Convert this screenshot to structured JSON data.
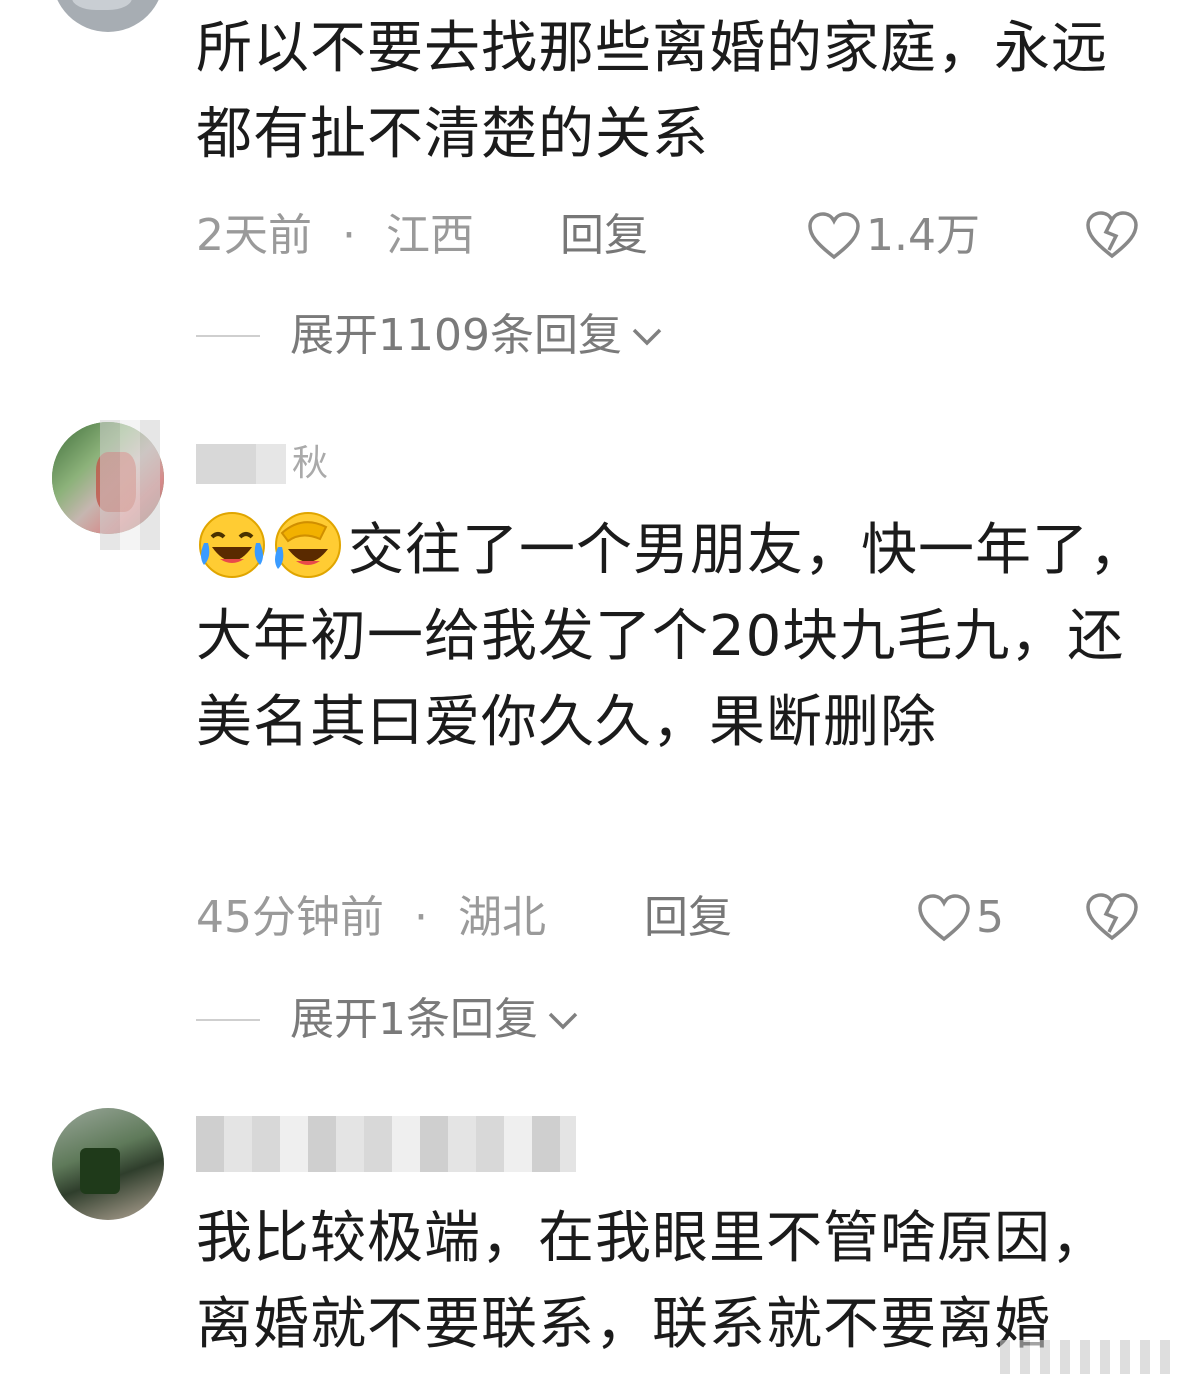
{
  "comments": [
    {
      "text": "所以不要去找那些离婚的家庭，永远都有扯不清楚的关系",
      "time": "2天前",
      "separator": "·",
      "location": "江西",
      "reply_label": "回复",
      "like_count": "1.4万",
      "expand_label": "展开1109条回复"
    },
    {
      "username_partial": "秋",
      "emojis": [
        "crying-laughing",
        "facepalm-laughing"
      ],
      "text": "交往了一个男朋友，快一年了，大年初一给我发了个20块九毛九，还美名其曰爱你久久，果断删除",
      "time": "45分钟前",
      "separator": "·",
      "location": "湖北",
      "reply_label": "回复",
      "like_count": "5",
      "expand_label": "展开1条回复"
    },
    {
      "text": "我比较极端，在我眼里不管啥原因，离婚就不要联系，联系就不要离婚"
    }
  ],
  "colors": {
    "text": "#1b1b1b",
    "meta": "#9a9a9a",
    "icon": "#888888"
  }
}
